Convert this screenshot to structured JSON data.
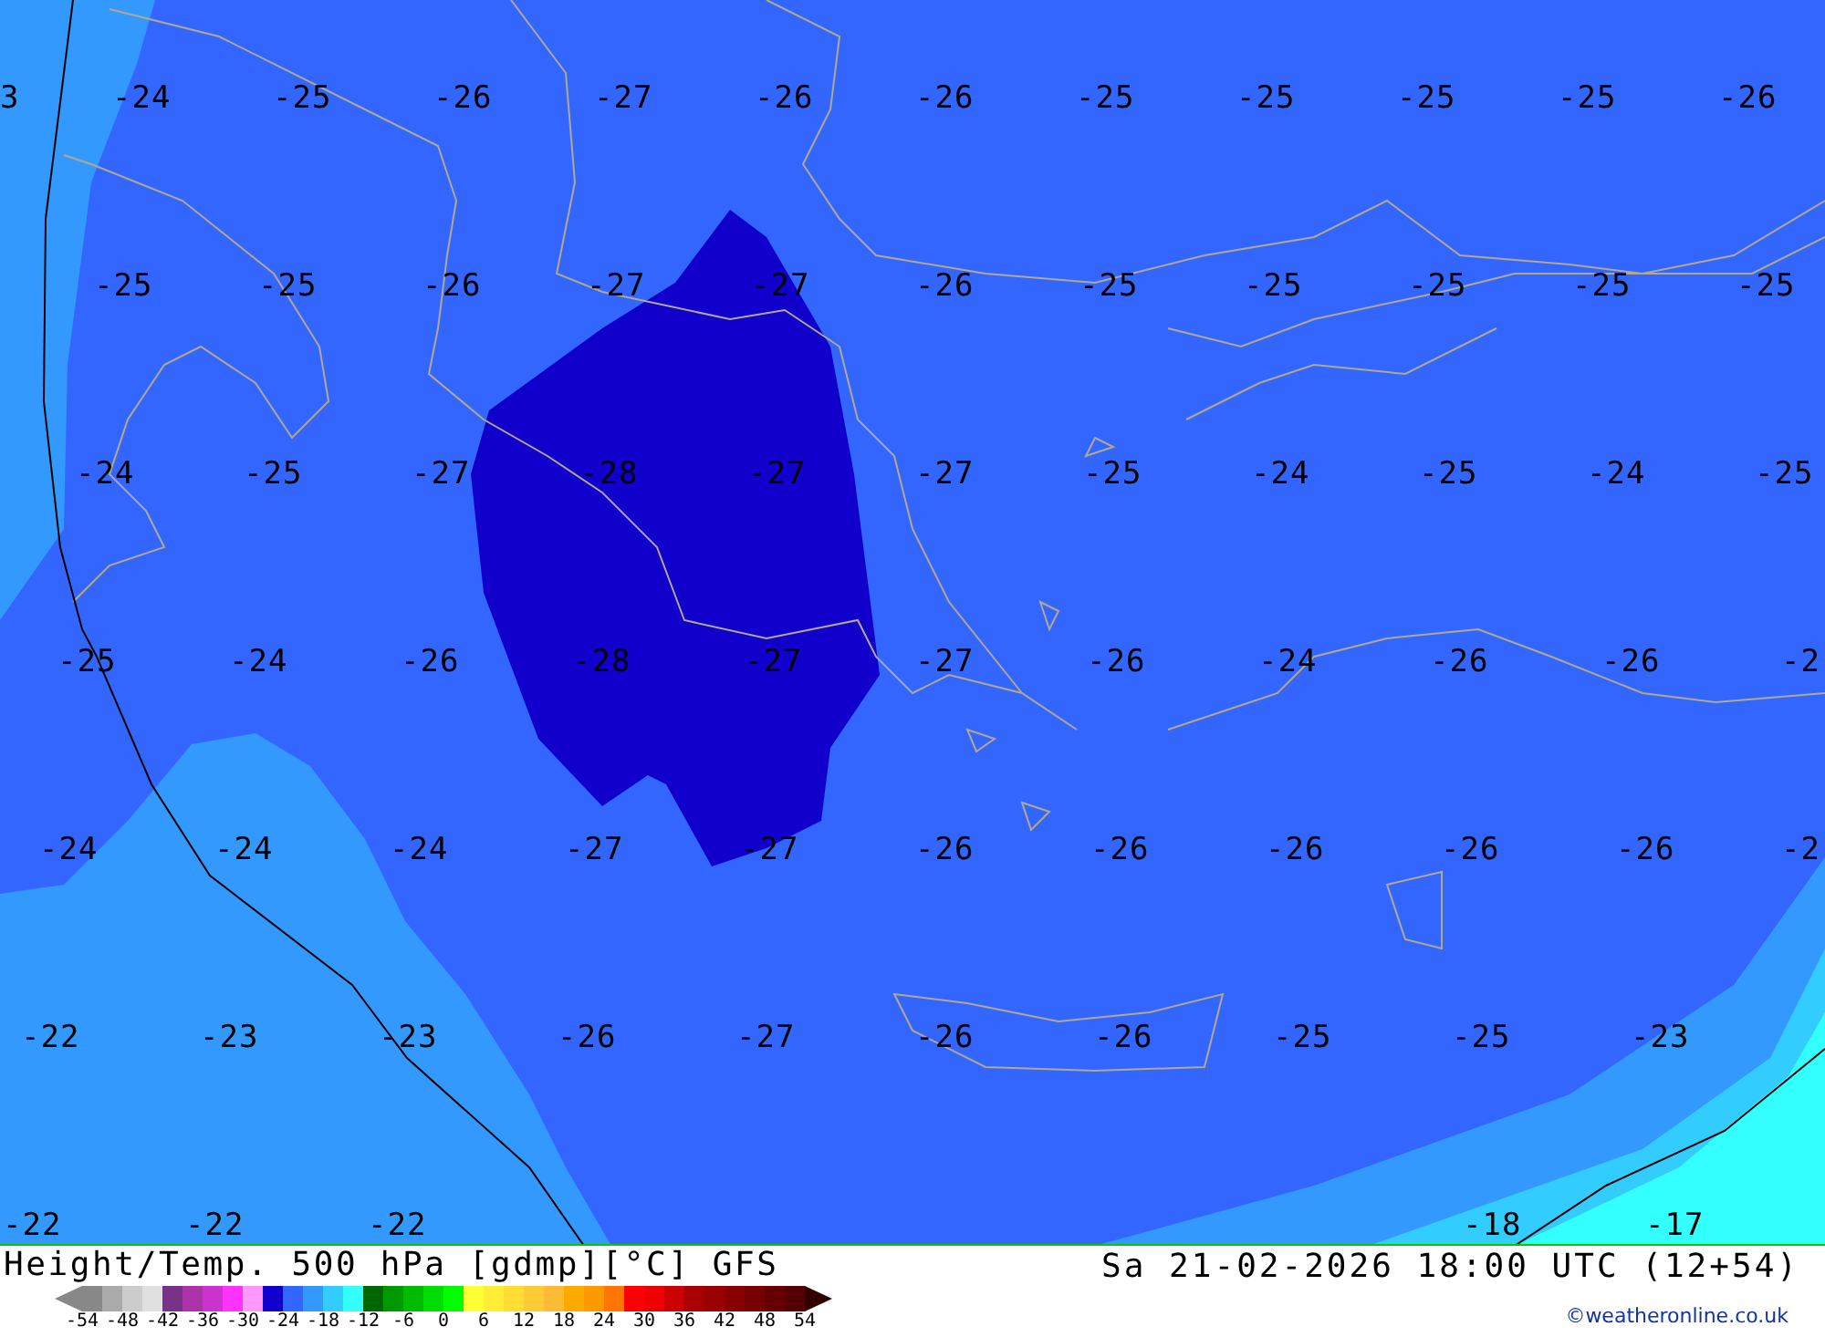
{
  "map": {
    "label_rows": [
      [
        "3",
        "-24",
        "-25",
        "-26",
        "-27",
        "-26",
        "-26",
        "-25",
        "-25",
        "-25",
        "-25",
        "-26"
      ],
      [
        null,
        "-25",
        "-25",
        "-26",
        "-27",
        "-27",
        "-26",
        "-25",
        "-25",
        "-25",
        "-25",
        "-25"
      ],
      [
        null,
        "-24",
        "-25",
        "-27",
        "-28",
        "-27",
        "-27",
        "-25",
        "-24",
        "-25",
        "-24",
        "-25"
      ],
      [
        null,
        "-25",
        "-24",
        "-26",
        "-28",
        "-27",
        "-27",
        "-26",
        "-24",
        "-26",
        "-26",
        "-2"
      ],
      [
        null,
        "-24",
        "-24",
        "-24",
        "-27",
        "-27",
        "-26",
        "-26",
        "-26",
        "-26",
        "-26",
        "-2"
      ],
      [
        null,
        "-22",
        "-23",
        "-23",
        "-26",
        "-27",
        "-26",
        "-26",
        "-25",
        "-25",
        "-23",
        null
      ],
      [
        null,
        "-22",
        "-22",
        "-22",
        null,
        null,
        null,
        null,
        null,
        "-18",
        "-17",
        null
      ]
    ]
  },
  "footer": {
    "title": "Height/Temp. 500 hPa [gdmp][°C] GFS",
    "timestamp": "Sa 21-02-2026 18:00 UTC (12+54)",
    "legend": {
      "swatches": [
        {
          "color": "#888888"
        },
        {
          "color": "#aaaaaa"
        },
        {
          "color": "#cccccc"
        },
        {
          "color": "#e0e0e0"
        },
        {
          "color": "#773388"
        },
        {
          "color": "#aa33aa"
        },
        {
          "color": "#cc33cc"
        },
        {
          "color": "#ff33ff"
        },
        {
          "color": "#ff99ff"
        },
        {
          "color": "#1100cc"
        },
        {
          "color": "#3366ff"
        },
        {
          "color": "#3399ff"
        },
        {
          "color": "#33ccff"
        },
        {
          "color": "#33ffff"
        },
        {
          "color": "#006600"
        },
        {
          "color": "#009900"
        },
        {
          "color": "#00bb00"
        },
        {
          "color": "#00dd00"
        },
        {
          "color": "#00ff00"
        },
        {
          "color": "#ffff33"
        },
        {
          "color": "#ffee33"
        },
        {
          "color": "#ffdd33"
        },
        {
          "color": "#ffcc33"
        },
        {
          "color": "#ffbb33"
        },
        {
          "color": "#ffaa00"
        },
        {
          "color": "#ff9900"
        },
        {
          "color": "#ff7700"
        },
        {
          "color": "#ff0000"
        },
        {
          "color": "#ee0000"
        },
        {
          "color": "#cc0000"
        },
        {
          "color": "#aa0000"
        },
        {
          "color": "#990000"
        },
        {
          "color": "#880000"
        },
        {
          "color": "#770000"
        },
        {
          "color": "#660000"
        },
        {
          "color": "#550000"
        }
      ],
      "ticks": [
        "-54",
        "-48",
        "-42",
        "-36",
        "-30",
        "-24",
        "-18",
        "-12",
        "-6",
        "0",
        "6",
        "12",
        "18",
        "24",
        "30",
        "36",
        "42",
        "48",
        "54"
      ]
    },
    "credit": "©weatheronline.co.uk"
  }
}
